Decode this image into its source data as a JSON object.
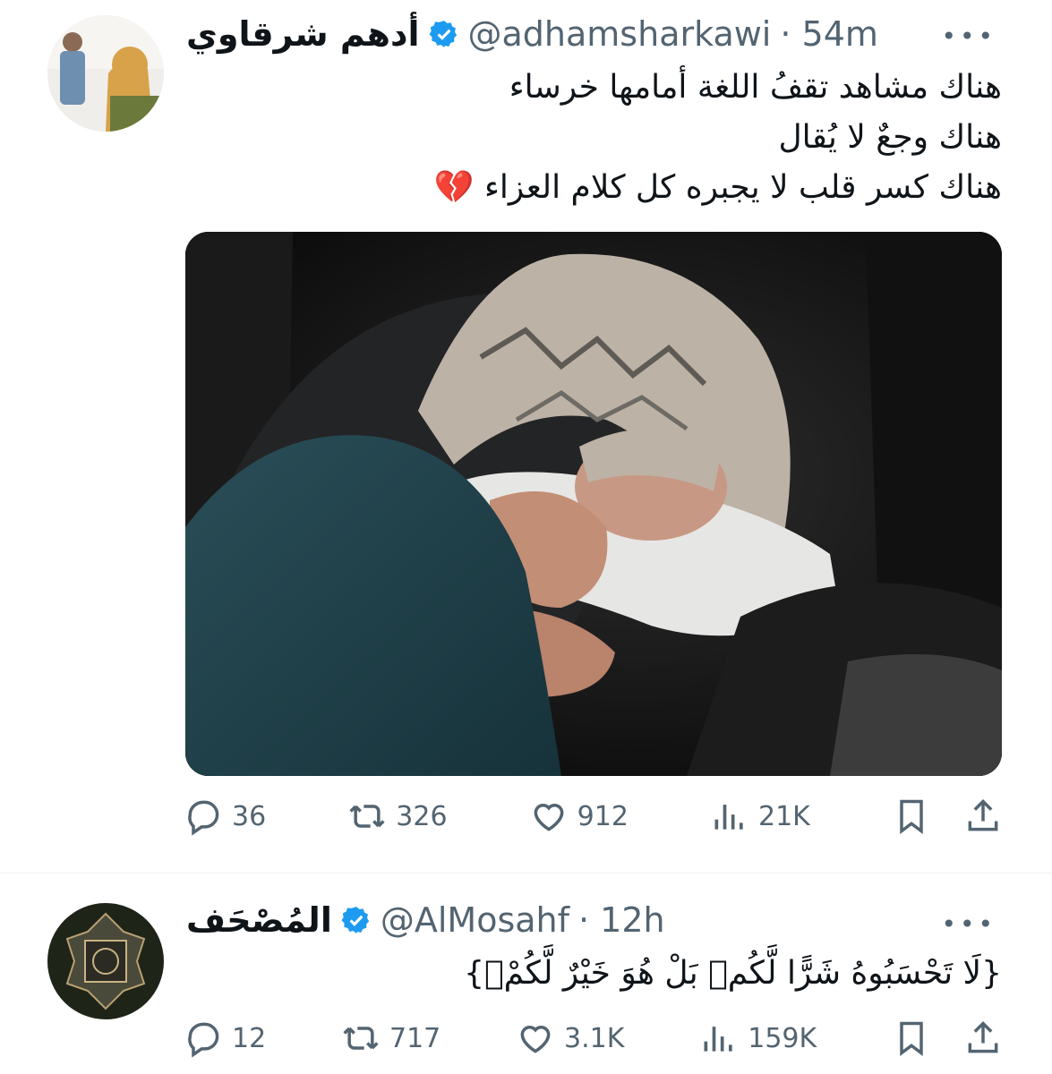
{
  "tweet1": {
    "name": "أدهم شرقاوي",
    "handle": "@adhamsharkawi",
    "time": "· 54m",
    "lines": [
      "هناك مشاهد تقفُ اللغة أمامها خرساء",
      "هناك وجعٌ لا يُقال",
      "هناك كسر قلب لا يجبره كل كلام العزاء 💔"
    ],
    "replies": "36",
    "reposts": "326",
    "likes": "912",
    "views": "21K"
  },
  "tweet2": {
    "name": "المُصْحَف",
    "handle": "@AlMosahf",
    "time": "· 12h",
    "text": "{لَا تَحْسَبُوهُ شَرًّا لَّكُمۖ بَلْ هُوَ خَيْرٌ لَّكُمْۚ}",
    "replies": "12",
    "reposts": "717",
    "likes": "3.1K",
    "views": "159K"
  },
  "icons": {
    "verified": "verified-badge-icon",
    "more": "more-icon",
    "reply": "reply-icon",
    "repost": "repost-icon",
    "like": "heart-icon",
    "views": "views-icon",
    "bookmark": "bookmark-icon",
    "share": "share-icon"
  },
  "colors": {
    "verified": "#1d9bf0",
    "secondary_text": "#536471",
    "primary_text": "#0f1419"
  }
}
